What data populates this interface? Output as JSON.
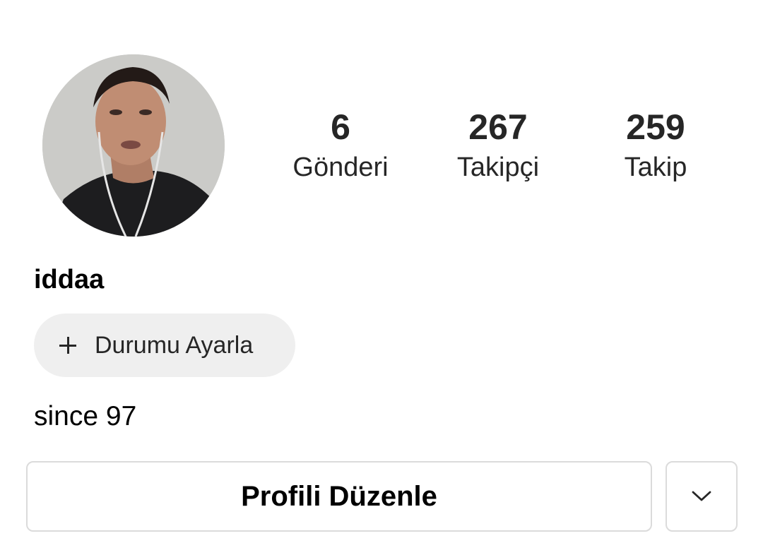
{
  "profile": {
    "username": "iddaa",
    "bio": "since 97",
    "avatar_icon": "profile-photo"
  },
  "stats": {
    "posts": {
      "count": "6",
      "label": "Gönderi"
    },
    "followers": {
      "count": "267",
      "label": "Takipçi"
    },
    "following": {
      "count": "259",
      "label": "Takip"
    }
  },
  "status": {
    "icon": "plus-icon",
    "label": "Durumu Ayarla"
  },
  "actions": {
    "edit_profile_label": "Profili Düzenle",
    "more_icon": "chevron-down-icon"
  },
  "colors": {
    "text": "#262626",
    "chip_background": "#efefef",
    "button_border": "#dbdbdb"
  }
}
